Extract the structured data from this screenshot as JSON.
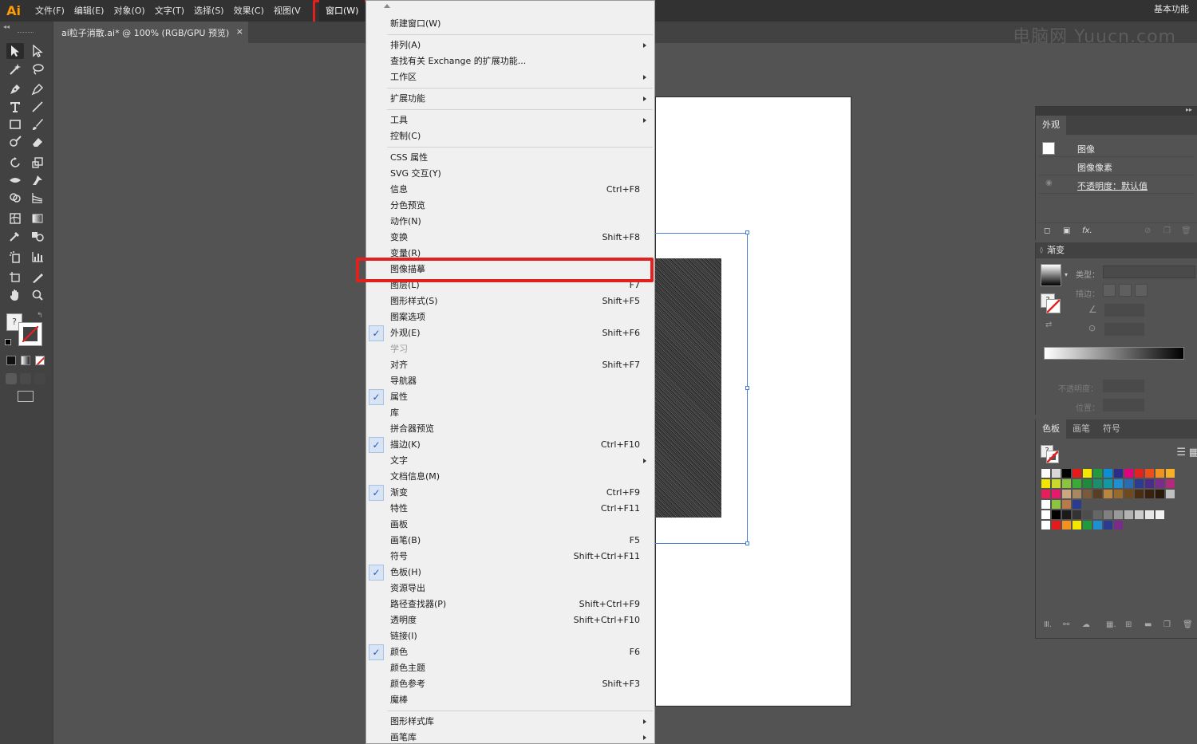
{
  "app": {
    "logo": "Ai"
  },
  "menubar": {
    "items": [
      "文件(F)",
      "编辑(E)",
      "对象(O)",
      "文字(T)",
      "选择(S)",
      "效果(C)",
      "视图(V"
    ],
    "window_menu": "窗口(W)",
    "workspace": "基本功能"
  },
  "document": {
    "tab_title": "ai粒子消散.ai* @ 100% (RGB/GPU 预览)",
    "tab_close": "×",
    "watermark": "电脑网 Yuucn.com"
  },
  "dropdown": {
    "items": [
      {
        "label": "新建窗口(W)",
        "shortcut": "",
        "submenu": false,
        "checked": false,
        "disabled": false
      },
      {
        "label": "排列(A)",
        "shortcut": "",
        "submenu": true,
        "checked": false,
        "disabled": false
      },
      {
        "label": "查找有关 Exchange 的扩展功能...",
        "shortcut": "",
        "submenu": false,
        "checked": false,
        "disabled": false
      },
      {
        "label": "工作区",
        "shortcut": "",
        "submenu": true,
        "checked": false,
        "disabled": false
      },
      {
        "label": "扩展功能",
        "shortcut": "",
        "submenu": true,
        "checked": false,
        "disabled": false
      },
      {
        "label": "工具",
        "shortcut": "",
        "submenu": true,
        "checked": false,
        "disabled": false
      },
      {
        "label": "控制(C)",
        "shortcut": "",
        "submenu": false,
        "checked": false,
        "disabled": false
      },
      {
        "label": "CSS 属性",
        "shortcut": "",
        "submenu": false,
        "checked": false,
        "disabled": false
      },
      {
        "label": "SVG 交互(Y)",
        "shortcut": "",
        "submenu": false,
        "checked": false,
        "disabled": false
      },
      {
        "label": "信息",
        "shortcut": "Ctrl+F8",
        "submenu": false,
        "checked": false,
        "disabled": false
      },
      {
        "label": "分色预览",
        "shortcut": "",
        "submenu": false,
        "checked": false,
        "disabled": false
      },
      {
        "label": "动作(N)",
        "shortcut": "",
        "submenu": false,
        "checked": false,
        "disabled": false
      },
      {
        "label": "变换",
        "shortcut": "Shift+F8",
        "submenu": false,
        "checked": false,
        "disabled": false
      },
      {
        "label": "变量(R)",
        "shortcut": "",
        "submenu": false,
        "checked": false,
        "disabled": false
      },
      {
        "label": "图像描摹",
        "shortcut": "",
        "submenu": false,
        "checked": false,
        "disabled": false
      },
      {
        "label": "图层(L)",
        "shortcut": "F7",
        "submenu": false,
        "checked": false,
        "disabled": false
      },
      {
        "label": "图形样式(S)",
        "shortcut": "Shift+F5",
        "submenu": false,
        "checked": false,
        "disabled": false
      },
      {
        "label": "图案选项",
        "shortcut": "",
        "submenu": false,
        "checked": false,
        "disabled": false
      },
      {
        "label": "外观(E)",
        "shortcut": "Shift+F6",
        "submenu": false,
        "checked": true,
        "disabled": false
      },
      {
        "label": "学习",
        "shortcut": "",
        "submenu": false,
        "checked": false,
        "disabled": true
      },
      {
        "label": "对齐",
        "shortcut": "Shift+F7",
        "submenu": false,
        "checked": false,
        "disabled": false
      },
      {
        "label": "导航器",
        "shortcut": "",
        "submenu": false,
        "checked": false,
        "disabled": false
      },
      {
        "label": "属性",
        "shortcut": "",
        "submenu": false,
        "checked": true,
        "disabled": false
      },
      {
        "label": "库",
        "shortcut": "",
        "submenu": false,
        "checked": false,
        "disabled": false
      },
      {
        "label": "拼合器预览",
        "shortcut": "",
        "submenu": false,
        "checked": false,
        "disabled": false
      },
      {
        "label": "描边(K)",
        "shortcut": "Ctrl+F10",
        "submenu": false,
        "checked": true,
        "disabled": false
      },
      {
        "label": "文字",
        "shortcut": "",
        "submenu": true,
        "checked": false,
        "disabled": false
      },
      {
        "label": "文档信息(M)",
        "shortcut": "",
        "submenu": false,
        "checked": false,
        "disabled": false
      },
      {
        "label": "渐变",
        "shortcut": "Ctrl+F9",
        "submenu": false,
        "checked": true,
        "disabled": false
      },
      {
        "label": "特性",
        "shortcut": "Ctrl+F11",
        "submenu": false,
        "checked": false,
        "disabled": false
      },
      {
        "label": "画板",
        "shortcut": "",
        "submenu": false,
        "checked": false,
        "disabled": false
      },
      {
        "label": "画笔(B)",
        "shortcut": "F5",
        "submenu": false,
        "checked": false,
        "disabled": false
      },
      {
        "label": "符号",
        "shortcut": "Shift+Ctrl+F11",
        "submenu": false,
        "checked": false,
        "disabled": false
      },
      {
        "label": "色板(H)",
        "shortcut": "",
        "submenu": false,
        "checked": true,
        "disabled": false
      },
      {
        "label": "资源导出",
        "shortcut": "",
        "submenu": false,
        "checked": false,
        "disabled": false
      },
      {
        "label": "路径查找器(P)",
        "shortcut": "Shift+Ctrl+F9",
        "submenu": false,
        "checked": false,
        "disabled": false
      },
      {
        "label": "透明度",
        "shortcut": "Shift+Ctrl+F10",
        "submenu": false,
        "checked": false,
        "disabled": false
      },
      {
        "label": "链接(I)",
        "shortcut": "",
        "submenu": false,
        "checked": false,
        "disabled": false
      },
      {
        "label": "颜色",
        "shortcut": "F6",
        "submenu": false,
        "checked": true,
        "disabled": false
      },
      {
        "label": "颜色主题",
        "shortcut": "",
        "submenu": false,
        "checked": false,
        "disabled": false
      },
      {
        "label": "颜色参考",
        "shortcut": "Shift+F3",
        "submenu": false,
        "checked": false,
        "disabled": false
      },
      {
        "label": "魔棒",
        "shortcut": "",
        "submenu": false,
        "checked": false,
        "disabled": false
      },
      {
        "label": "图形样式库",
        "shortcut": "",
        "submenu": true,
        "checked": false,
        "disabled": false
      },
      {
        "label": "画笔库",
        "shortcut": "",
        "submenu": true,
        "checked": false,
        "disabled": false
      }
    ],
    "highlighted": "图像描摹",
    "check_mark": "✓"
  },
  "appearance_panel": {
    "tab": "外观",
    "rows": [
      "图像",
      "图像像素",
      "不透明度：默认值"
    ],
    "footer_fx": "fx."
  },
  "gradient_panel": {
    "title": "渐变",
    "type_label": "类型：",
    "stroke_label": "描边：",
    "opacity_label": "不透明度：",
    "location_label": "位置："
  },
  "swatches_panel": {
    "tabs": [
      "色板",
      "画笔",
      "符号"
    ],
    "rows": [
      [
        "#ffffff",
        "#d8d8d8",
        "#000000",
        "#e51a1a",
        "#f5e600",
        "#1f9a3c",
        "#0b8fd4",
        "#2c2c8c",
        "#e4007f",
        "#e5231e",
        "#ee4e1a",
        "#f2911f",
        "#f7b127"
      ],
      [
        "#f2e600",
        "#c8d92a",
        "#8cc43f",
        "#3aa935",
        "#1f8a3c",
        "#1b8f6a",
        "#0f9aa3",
        "#1e8fd1",
        "#2a6cb4",
        "#2b3b92",
        "#4a2c8a",
        "#7b2b8c",
        "#b22a7e"
      ],
      [
        "#e61e5a",
        "#e6196e",
        "#c9a880",
        "#a88860",
        "#7a5a3a",
        "#5a3e24",
        "#b8863c",
        "#9a6a2a",
        "#6e4a1e",
        "#4a2e12",
        "#3a2210",
        "#2a1a0a",
        "#c0c0c0"
      ],
      [
        "#ffffff",
        "#8cc43f",
        "#b87a4a",
        "#2b3b92"
      ],
      [
        "#ffffff",
        "#000000",
        "#1a1a1a",
        "#333333",
        "#4d4d4d",
        "#666666",
        "#808080",
        "#999999",
        "#b3b3b3",
        "#cccccc",
        "#e6e6e6",
        "#f2f2f2"
      ],
      [
        "#ffffff",
        "#e51a1a",
        "#f2911f",
        "#f5e600",
        "#1f9a3c",
        "#1e8fd1",
        "#2b3b92",
        "#7b2b8c"
      ]
    ]
  }
}
